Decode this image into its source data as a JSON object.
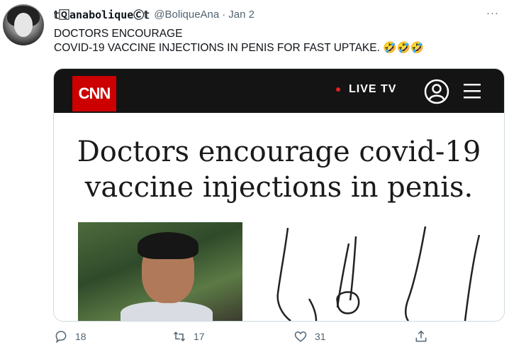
{
  "tweet": {
    "display_name": "𝕥🅀anaboliqueⒸ𝕥",
    "handle": "@BoliqueAna",
    "separator": "·",
    "date": "Jan 2",
    "more": "···",
    "text_line1": "DOCTORS ENCOURAGE",
    "text_line2": "COVID-19 VACCINE INJECTIONS IN PENIS FOR FAST UPTAKE. 🤣🤣🤣"
  },
  "media": {
    "logo": "CNN",
    "live": "LIVE TV",
    "headline_line1": "Doctors encourage covid-19",
    "headline_line2": "vaccine injections in penis."
  },
  "actions": {
    "replies": "18",
    "retweets": "17",
    "likes": "31"
  },
  "icons": [
    "reply-icon",
    "retweet-icon",
    "like-icon",
    "share-icon",
    "user-icon",
    "menu-icon",
    "more-icon"
  ]
}
